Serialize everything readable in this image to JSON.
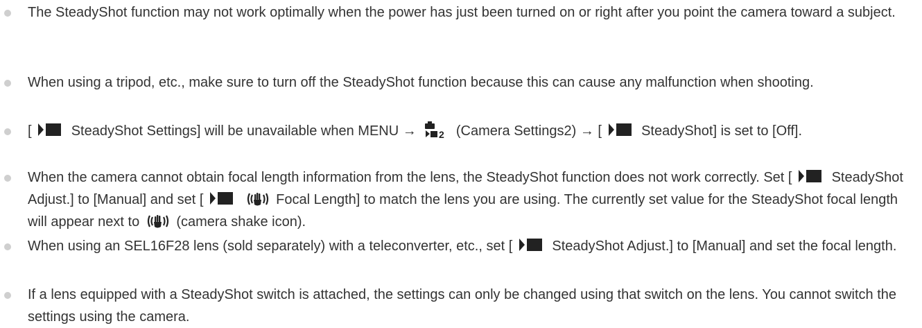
{
  "notes": {
    "n1": "The SteadyShot function may not work optimally when the power has just been turned on or right after you point the camera toward a subject.",
    "n2": "When using a tripod, etc., make sure to turn off the SteadyShot function because this can cause any malfunction when shooting.",
    "n3": {
      "p1": "[",
      "p2": "SteadyShot Settings] will be unavailable when MENU →",
      "p3": "(Camera Settings2) → [",
      "p4": "SteadyShot] is set to [Off]."
    },
    "n4": {
      "p1": "When the camera cannot obtain focal length information from the lens, the SteadyShot function does not work correctly. Set [",
      "p2": "SteadyShot Adjust.] to [Manual] and set [",
      "p3": "Focal Length] to match the lens you are using. The currently set value for the SteadyShot focal length will appear next to",
      "p4": "(camera shake icon)."
    },
    "n5": {
      "p1": "When using an SEL16F28 lens (sold separately) with a teleconverter, etc., set [",
      "p2": "SteadyShot Adjust.] to [Manual] and set the focal length."
    },
    "n6": "If a lens equipped with a SteadyShot switch is attached, the settings can only be changed using that switch on the lens. You cannot switch the settings using the camera.",
    "icons": {
      "movie": "movie-mode-icon",
      "camera_settings": "camera-settings2-icon",
      "shake": "camera-shake-icon",
      "camera_settings_number": "2"
    },
    "colors": {
      "text": "#333333",
      "bullet": "#cfcfcf",
      "icon": "#222222"
    }
  }
}
